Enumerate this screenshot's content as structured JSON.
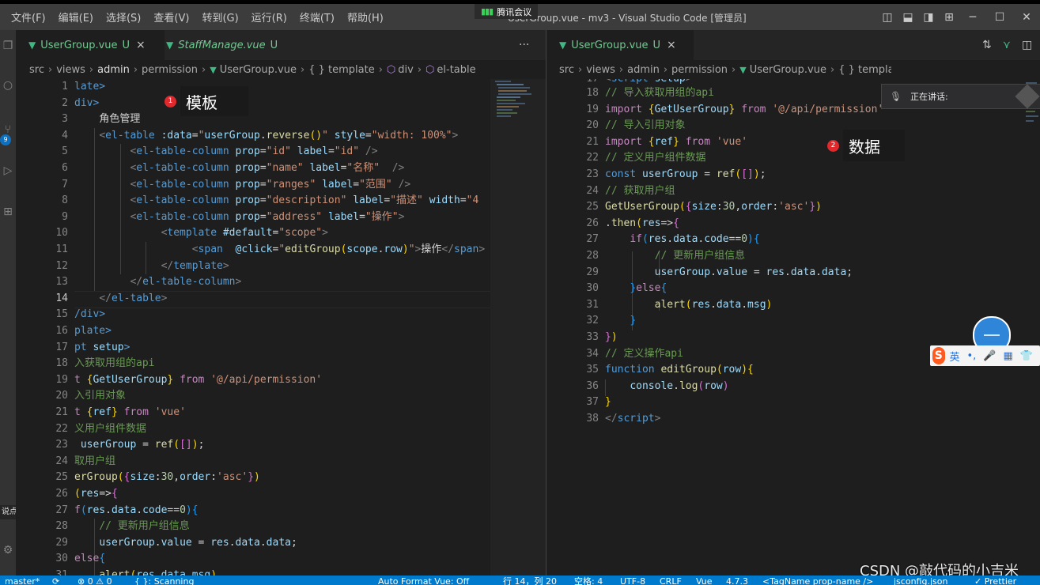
{
  "menu": [
    "文件(F)",
    "编辑(E)",
    "选择(S)",
    "查看(V)",
    "转到(G)",
    "运行(R)",
    "终端(T)",
    "帮助(H)"
  ],
  "window_title": "UserGroup.vue - mv3 - Visual Studio Code [管理员]",
  "meeting_label": "腾讯会议",
  "activity_badge": "9",
  "tooltip_text": "说点什么...",
  "left_tabs": [
    {
      "name": "UserGroup.vue",
      "status": "U",
      "close": "×",
      "italic": false
    },
    {
      "name": "StaffManage.vue",
      "status": "U",
      "close": "",
      "italic": true
    }
  ],
  "right_tabs": [
    {
      "name": "UserGroup.vue",
      "status": "U",
      "close": "×",
      "italic": false
    }
  ],
  "more_actions": "···",
  "left_breadcrumb": [
    "src",
    "views",
    "admin",
    "permission",
    "UserGroup.vue",
    "{ } template",
    "div",
    "el-table"
  ],
  "right_breadcrumb": [
    "src",
    "views",
    "admin",
    "permission",
    "UserGroup.vue",
    "{ } template",
    "div",
    "el-table"
  ],
  "annotations": [
    {
      "num": "1",
      "text": "模板"
    },
    {
      "num": "2",
      "text": "数据"
    }
  ],
  "voice_widget": {
    "label": "正在讲话:"
  },
  "ime_toolbar": {
    "logo": "S",
    "lang": "英",
    "punct": "•,",
    "mic": "🎤",
    "grid": "▦",
    "shirt": "👕"
  },
  "watermark": "CSDN @敲代码的小吉米",
  "status_bar": {
    "branch": "master*",
    "sync": "⟳",
    "problems": "⊗ 0 ⚠ 0",
    "scanning": "{ }: Scanning",
    "auto_format": "Auto Format Vue: Off",
    "cursor": "行 14，列 20",
    "spaces": "空格: 4",
    "encoding": "UTF-8",
    "eol": "CRLF",
    "language": "Vue",
    "version": "4.7.3",
    "snippet": "<TagName prop-name />",
    "jsconfig": "jsconfig.json",
    "prettier": "✓ Prettier"
  }
}
